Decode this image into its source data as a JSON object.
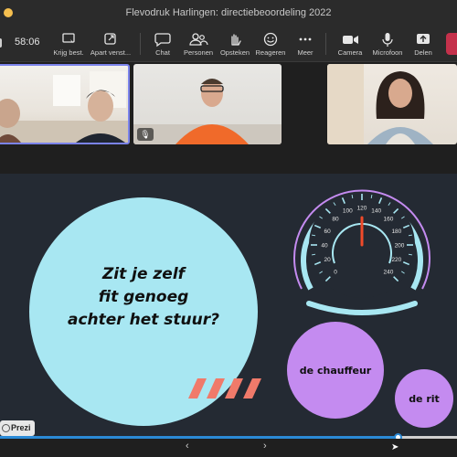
{
  "window": {
    "title": "Flevodruk Harlingen: directiebeoordeling 2022"
  },
  "toolbar": {
    "timer": "58:06",
    "buttons": [
      {
        "label": "Krijg best.",
        "icon": "take-control-icon"
      },
      {
        "label": "Apart venst...",
        "icon": "pop-out-icon"
      },
      {
        "label": "Chat",
        "icon": "chat-icon"
      },
      {
        "label": "Personen",
        "icon": "people-icon"
      },
      {
        "label": "Opsteken",
        "icon": "raise-hand-icon"
      },
      {
        "label": "Reageren",
        "icon": "react-icon"
      },
      {
        "label": "Meer",
        "icon": "more-icon"
      },
      {
        "label": "Camera",
        "icon": "camera-icon"
      },
      {
        "label": "Microfoon",
        "icon": "microphone-icon"
      },
      {
        "label": "Delen",
        "icon": "share-icon"
      }
    ]
  },
  "slide": {
    "main_text": [
      "Zit je zelf",
      "fit genoeg",
      "achter het stuur?"
    ],
    "circle_1": "de chauffeur",
    "circle_2": "de rit",
    "gauge_ticks": [
      "0",
      "20",
      "40",
      "60",
      "80",
      "100",
      "120",
      "140",
      "160",
      "180",
      "200",
      "220",
      "240"
    ],
    "gauge_value": 120,
    "colors": {
      "cyan": "#a8e7f2",
      "purple": "#c48bf0",
      "stripes": "#f07a6a",
      "background": "#242a33"
    }
  },
  "prezi": {
    "label": "Prezi",
    "progress": 0.87
  },
  "nav": {
    "prev": "‹",
    "next": "›"
  }
}
